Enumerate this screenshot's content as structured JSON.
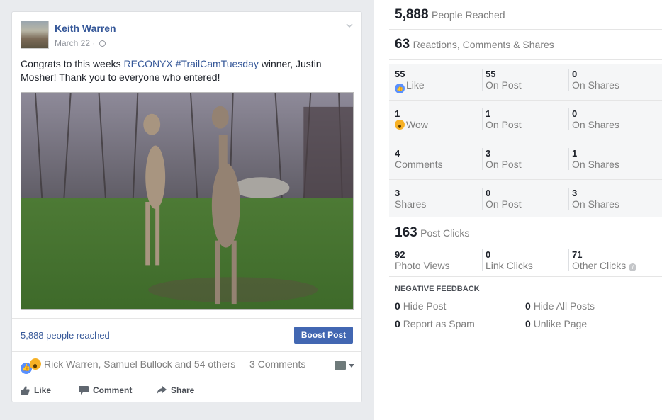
{
  "post": {
    "author": "Keith Warren",
    "date": "March 22",
    "text_prefix": "Congrats to this weeks ",
    "text_tag1": "RECONYX",
    "text_tag2": "#TrailCamTuesday",
    "text_suffix": " winner, Justin Mosher! Thank you to everyone who entered!",
    "reach_text": "5,888 people reached",
    "boost_label": "Boost Post",
    "reactions_text": "Rick Warren, Samuel Bullock and 54 others",
    "comments_text": "3 Comments",
    "actions": {
      "like": "Like",
      "comment": "Comment",
      "share": "Share"
    }
  },
  "stats": {
    "people_reached": {
      "value": "5,888",
      "label": "People Reached"
    },
    "engagement": {
      "value": "63",
      "label": "Reactions, Comments & Shares"
    },
    "rows": [
      {
        "total": "55",
        "label": "Like",
        "on_post": "55",
        "on_post_label": "On Post",
        "on_shares": "0",
        "on_shares_label": "On Shares",
        "icon": "like-icon"
      },
      {
        "total": "1",
        "label": "Wow",
        "on_post": "1",
        "on_post_label": "On Post",
        "on_shares": "0",
        "on_shares_label": "On Shares",
        "icon": "wow-icon"
      },
      {
        "total": "4",
        "label": "Comments",
        "on_post": "3",
        "on_post_label": "On Post",
        "on_shares": "1",
        "on_shares_label": "On Shares"
      },
      {
        "total": "3",
        "label": "Shares",
        "on_post": "0",
        "on_post_label": "On Post",
        "on_shares": "3",
        "on_shares_label": "On Shares"
      }
    ],
    "post_clicks": {
      "value": "163",
      "label": "Post Clicks"
    },
    "clicks": [
      {
        "value": "92",
        "label": "Photo Views"
      },
      {
        "value": "0",
        "label": "Link Clicks"
      },
      {
        "value": "71",
        "label": "Other Clicks"
      }
    ],
    "negative_title": "NEGATIVE FEEDBACK",
    "negative": [
      {
        "value": "0",
        "label": "Hide Post"
      },
      {
        "value": "0",
        "label": "Hide All Posts"
      },
      {
        "value": "0",
        "label": "Report as Spam"
      },
      {
        "value": "0",
        "label": "Unlike Page"
      }
    ]
  },
  "colors": {
    "link": "#365899",
    "button": "#4267b2",
    "like": "#5890ff",
    "wow": "#f7b125"
  }
}
